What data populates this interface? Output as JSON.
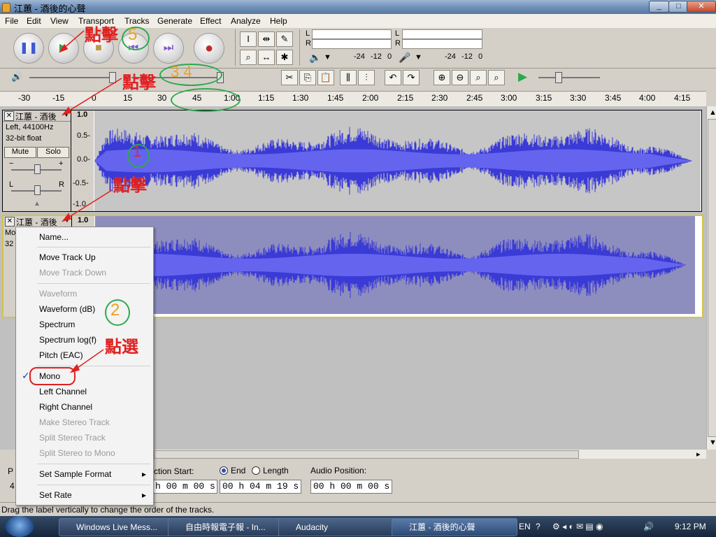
{
  "window": {
    "title": "江蕙 - 酒後的心聲",
    "controls": [
      "_",
      "□",
      "✕"
    ]
  },
  "menubar": [
    "File",
    "Edit",
    "View",
    "Transport",
    "Tracks",
    "Generate",
    "Effect",
    "Analyze",
    "Help"
  ],
  "transport": {
    "buttons": [
      "pause",
      "play",
      "stop",
      "skip-start",
      "skip-end",
      "record"
    ]
  },
  "meters": {
    "l": "L",
    "r": "R",
    "scale_left": [
      "-24",
      "-12",
      "0"
    ],
    "scale_right": [
      "-24",
      "-12",
      "0"
    ]
  },
  "ruler": {
    "ticks": [
      "-30",
      "-15",
      "0",
      "15",
      "30",
      "45",
      "1:00",
      "1:15",
      "1:30",
      "1:45",
      "2:00",
      "2:15",
      "2:30",
      "2:45",
      "3:00",
      "3:15",
      "3:30",
      "3:45",
      "4:00",
      "4:15"
    ]
  },
  "track1": {
    "name": "江蕙 - 酒後",
    "info1": "Left, 44100Hz",
    "info2": "32-bit float",
    "mute": "Mute",
    "solo": "Solo",
    "gain_minus": "−",
    "gain_plus": "+",
    "pan_l": "L",
    "pan_r": "R",
    "scale": [
      "1.0",
      "0.5-",
      "0.0-",
      "-0.5-",
      "-1.0"
    ]
  },
  "track2": {
    "name": "江蕙 - 酒後",
    "info1": "Mo",
    "info2": "32",
    "scale_top": "1.0"
  },
  "context_menu": {
    "items": [
      {
        "label": "Name...",
        "disabled": false
      },
      {
        "label": "Move Track Up",
        "disabled": false
      },
      {
        "label": "Move Track Down",
        "disabled": true
      },
      {
        "label": "Waveform",
        "disabled": true
      },
      {
        "label": "Waveform (dB)",
        "disabled": false
      },
      {
        "label": "Spectrum",
        "disabled": false
      },
      {
        "label": "Spectrum log(f)",
        "disabled": false
      },
      {
        "label": "Pitch (EAC)",
        "disabled": false
      },
      {
        "label": "Mono",
        "disabled": false,
        "checked": true
      },
      {
        "label": "Left Channel",
        "disabled": false
      },
      {
        "label": "Right Channel",
        "disabled": false
      },
      {
        "label": "Make Stereo Track",
        "disabled": true
      },
      {
        "label": "Split Stereo Track",
        "disabled": true
      },
      {
        "label": "Split Stereo to Mono",
        "disabled": true
      },
      {
        "label": "Set Sample Format",
        "disabled": false,
        "submenu": true
      },
      {
        "label": "Set Rate",
        "disabled": false,
        "submenu": true
      }
    ],
    "check_mark": "✓",
    "submenu_arrow": "▸"
  },
  "annotations": {
    "click": "點擊",
    "select": "點選",
    "n1": "1",
    "n2": "2",
    "n34": "3 4",
    "n5": "5"
  },
  "selection_bar": {
    "p_label": "P",
    "p_value": "4",
    "start_label": "ction Start:",
    "start_value": "h 00 m 00 s",
    "end_label": "End",
    "length_label": "Length",
    "end_value": "00 h 04 m 19 s",
    "audio_pos_label": "Audio Position:",
    "audio_pos_value": "00 h 00 m 00 s"
  },
  "status": "Drag the label vertically to change the order of the tracks.",
  "taskbar": {
    "tasks": [
      "Windows Live Mess...",
      "自由時報電子報 - In...",
      "Audacity",
      "江蕙 - 酒後的心聲"
    ],
    "lang": "EN",
    "clock": "9:12 PM"
  },
  "colors": {
    "waveform": "#3a3ad6",
    "annotation_red": "#e02020",
    "annotation_green": "#2fa84f",
    "annotation_orange": "#f0a020"
  }
}
